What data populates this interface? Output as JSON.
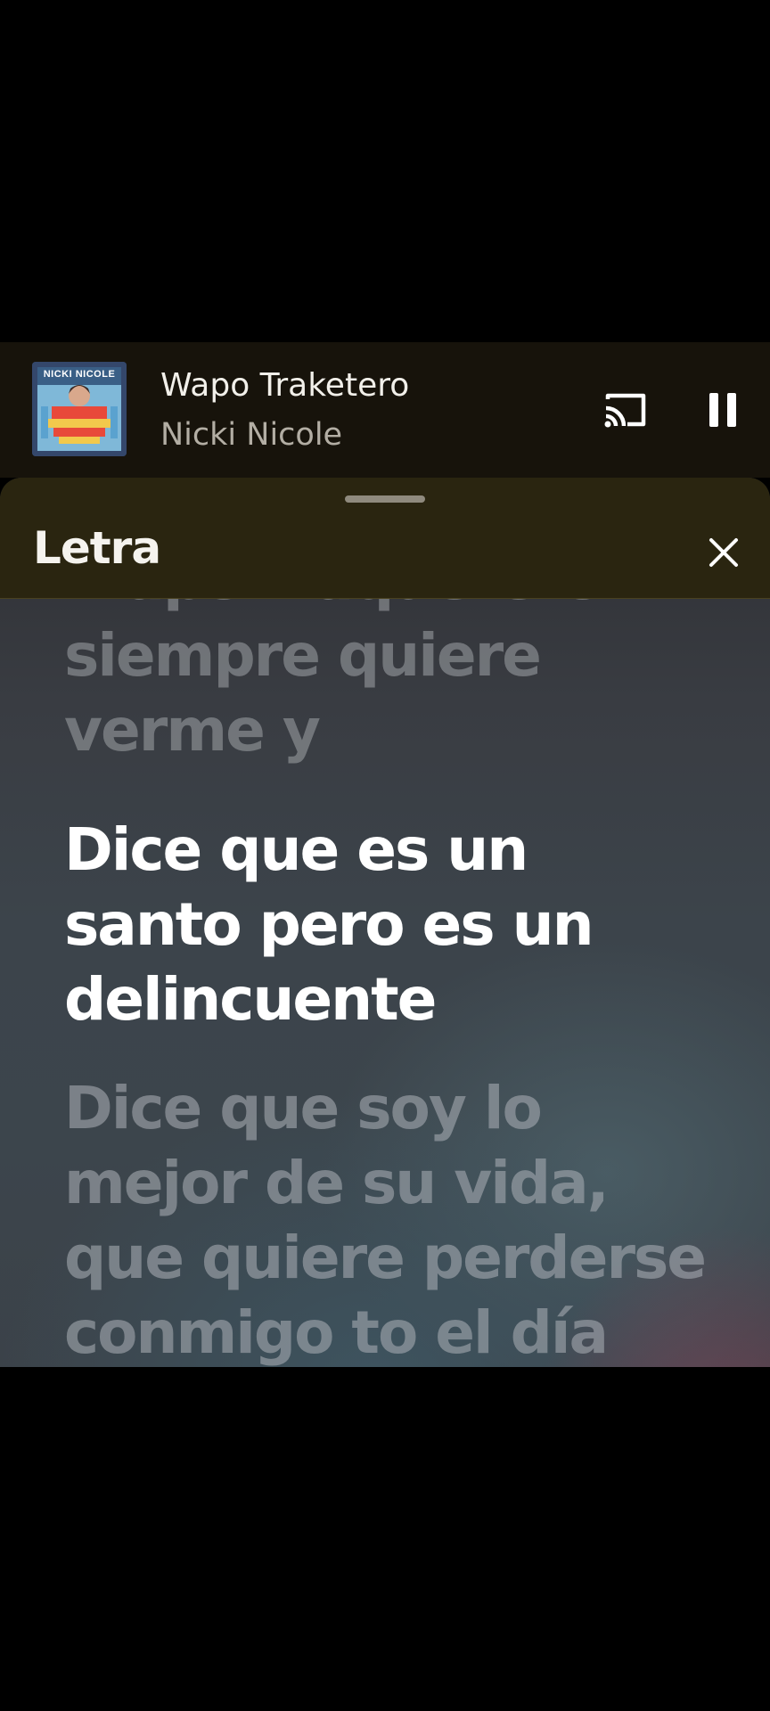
{
  "mini_player": {
    "album_art_text": "NICKI NICOLE",
    "track_title": "Wapo Traketero",
    "artist": "Nicki Nicole",
    "icons": {
      "album_art": "album-art-icon",
      "cast": "cast-icon",
      "pause": "pause-icon"
    }
  },
  "lyrics_sheet": {
    "title": "Letra",
    "icons": {
      "drag_handle": "drag-handle",
      "close": "close-icon"
    },
    "lines": {
      "partial_top": "Wapo traquetero",
      "previous": "siempre quiere\nverme y",
      "current": "Dice que es un\nsanto pero es un\ndelincuente",
      "next": "Dice que soy lo\nmejor de su vida,\nque quiere perderse\nconmigo to el día"
    }
  },
  "colors": {
    "background": "#000000",
    "mini_player_bg": "#17130b",
    "header_bg": "#2a2510",
    "active_lyric": "#ffffff",
    "inactive_lyric": "#a0a4a8"
  }
}
